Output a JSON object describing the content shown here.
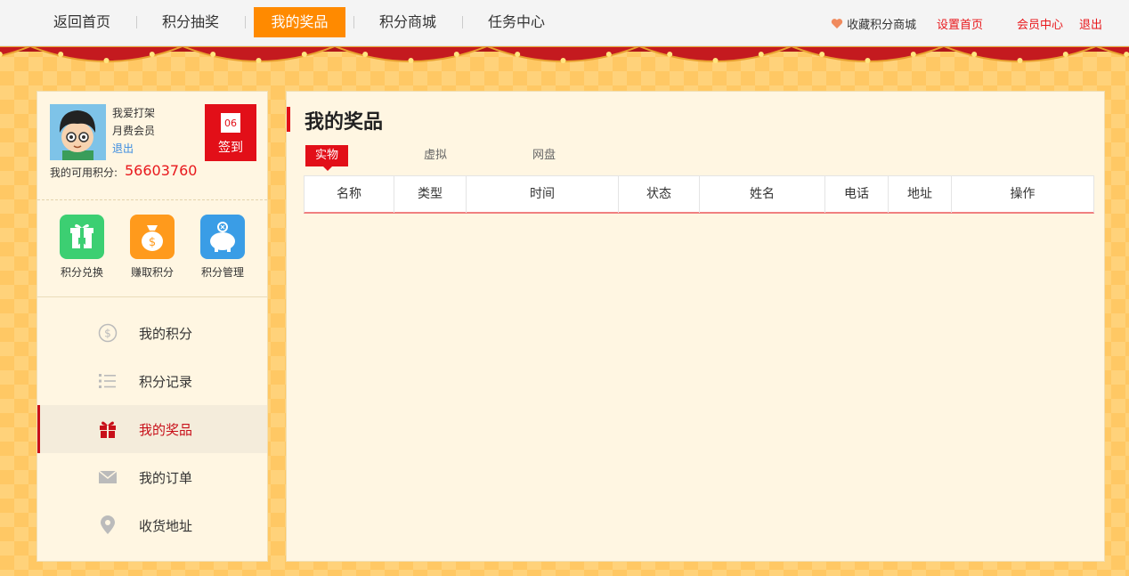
{
  "nav": {
    "items": [
      {
        "label": "返回首页",
        "active": false
      },
      {
        "label": "积分抽奖",
        "active": false
      },
      {
        "label": "我的奖品",
        "active": true
      },
      {
        "label": "积分商城",
        "active": false
      },
      {
        "label": "任务中心",
        "active": false
      }
    ],
    "favorite": "收藏积分商城",
    "set_home": "设置首页",
    "member_center": "会员中心",
    "logout": "退出"
  },
  "user": {
    "name": "我爱打架",
    "level": "月费会员",
    "logout": "退出",
    "points_label": "我的可用积分:",
    "points_value": "56603760",
    "checkin_day": "06",
    "checkin_label": "签到"
  },
  "quick_actions": [
    {
      "label": "积分兑换",
      "icon": "gift-box-icon",
      "color": "#3ccf72"
    },
    {
      "label": "赚取积分",
      "icon": "money-bag-icon",
      "color": "#ff9a1c"
    },
    {
      "label": "积分管理",
      "icon": "piggy-bank-icon",
      "color": "#3a9de6"
    }
  ],
  "menu": [
    {
      "label": "我的积分",
      "icon": "dollar-circle-icon",
      "active": false
    },
    {
      "label": "积分记录",
      "icon": "list-icon",
      "active": false
    },
    {
      "label": "我的奖品",
      "icon": "gift-icon",
      "active": true
    },
    {
      "label": "我的订单",
      "icon": "envelope-icon",
      "active": false
    },
    {
      "label": "收货地址",
      "icon": "location-pin-icon",
      "active": false
    }
  ],
  "main": {
    "title": "我的奖品",
    "tabs": [
      {
        "label": "实物",
        "active": true
      },
      {
        "label": "虚拟",
        "active": false
      },
      {
        "label": "网盘",
        "active": false
      }
    ],
    "columns": [
      "名称",
      "类型",
      "时间",
      "状态",
      "姓名",
      "电话",
      "地址",
      "操作"
    ]
  },
  "colors": {
    "accent_red": "#e20f18",
    "nav_active": "#ff8a00",
    "panel_bg": "#fff6e2"
  }
}
